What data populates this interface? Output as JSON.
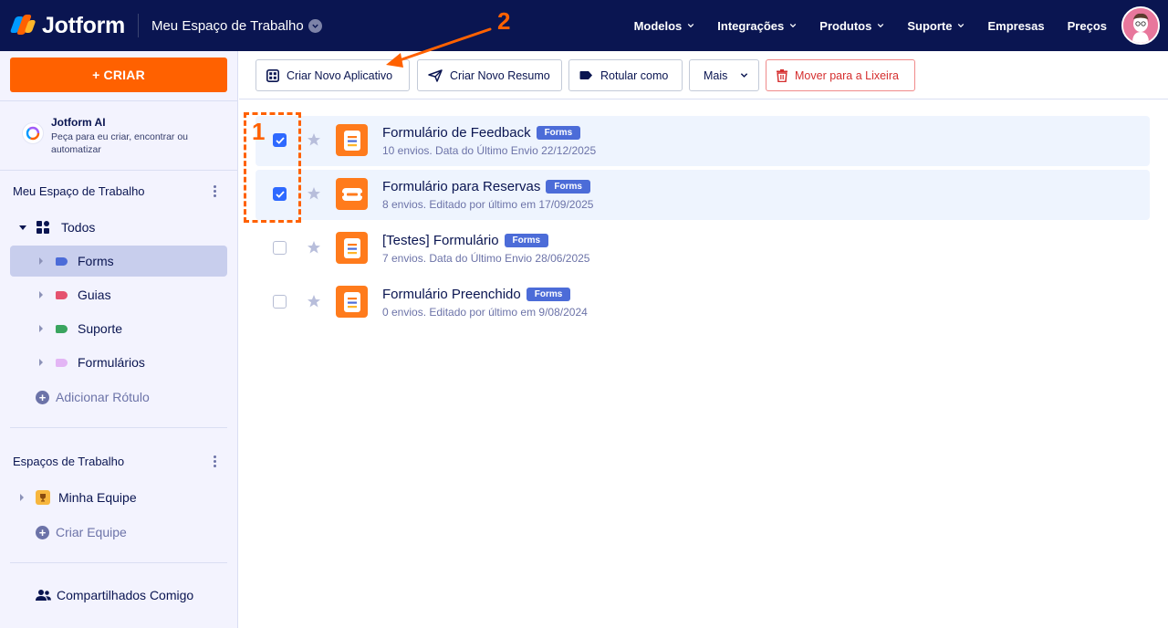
{
  "topbar": {
    "brand": "Jotform",
    "workspace_title": "Meu Espaço de Trabalho",
    "nav": [
      {
        "label": "Modelos",
        "has_menu": true
      },
      {
        "label": "Integrações",
        "has_menu": true
      },
      {
        "label": "Produtos",
        "has_menu": true
      },
      {
        "label": "Suporte",
        "has_menu": true
      },
      {
        "label": "Empresas",
        "has_menu": false
      },
      {
        "label": "Preços",
        "has_menu": false
      }
    ]
  },
  "sidebar": {
    "create_label": "+ CRIAR",
    "ai": {
      "title": "Jotform AI",
      "subtitle": "Peça para eu criar, encontrar ou automatizar"
    },
    "workspace_section": "Meu Espaço de Trabalho",
    "all_label": "Todos",
    "labels": [
      {
        "label": "Forms",
        "color": "#4c6cd8",
        "selected": true
      },
      {
        "label": "Guias",
        "color": "#e5536f",
        "selected": false
      },
      {
        "label": "Suporte",
        "color": "#3aa45f",
        "selected": false
      },
      {
        "label": "Formulários",
        "color": "#e3b5f5",
        "selected": false
      }
    ],
    "add_label": "Adicionar Rótulo",
    "teams_section": "Espaços de Trabalho",
    "team_name": "Minha Equipe",
    "create_team": "Criar Equipe",
    "shared_with_me": "Compartilhados Comigo"
  },
  "toolbar": {
    "create_app": "Criar Novo Aplicativo",
    "create_summary": "Criar Novo Resumo",
    "label_as": "Rotular como",
    "more": "Mais",
    "trash": "Mover para a Lixeira"
  },
  "forms": [
    {
      "title": "Formulário de Feedback",
      "badge": "Forms",
      "meta": "10 envios. Data do Último Envio 22/12/2025",
      "checked": true,
      "icon": "form-list-icon"
    },
    {
      "title": "Formulário para Reservas",
      "badge": "Forms",
      "meta": "8 envios. Editado por último em 17/09/2025",
      "checked": true,
      "icon": "form-card-icon"
    },
    {
      "title": "[Testes] Formulário",
      "badge": "Forms",
      "meta": "7 envios. Data do Último Envio 28/06/2025",
      "checked": false,
      "icon": "form-list-icon"
    },
    {
      "title": "Formulário Preenchido",
      "badge": "Forms",
      "meta": "0 envios. Editado por último em 9/08/2024",
      "checked": false,
      "icon": "form-list-icon"
    }
  ],
  "annotations": {
    "step1": "1",
    "step2": "2"
  },
  "colors": {
    "navy": "#0a1551",
    "orange": "#ff6100",
    "blue": "#2e69ff",
    "trash": "#d52f2f"
  }
}
